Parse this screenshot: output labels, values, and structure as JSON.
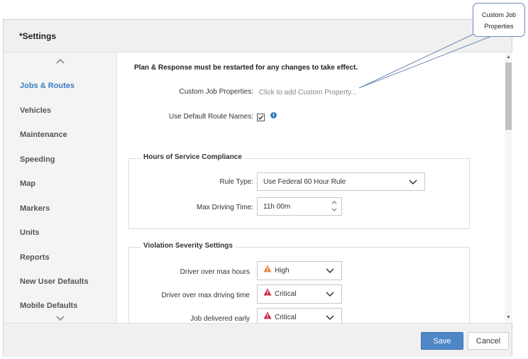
{
  "dialog": {
    "title": "*Settings",
    "sidebar": {
      "items": [
        {
          "label": "Jobs & Routes",
          "active": true
        },
        {
          "label": "Vehicles"
        },
        {
          "label": "Maintenance"
        },
        {
          "label": "Speeding"
        },
        {
          "label": "Map"
        },
        {
          "label": "Markers"
        },
        {
          "label": "Units"
        },
        {
          "label": "Reports"
        },
        {
          "label": "New User Defaults"
        },
        {
          "label": "Mobile Defaults"
        }
      ]
    },
    "notice": "Plan & Response must be restarted for any changes to take effect.",
    "custom_job_properties": {
      "label": "Custom Job Properties:",
      "placeholder": "Click to add Custom Property..."
    },
    "default_route_names": {
      "label": "Use Default Route Names:",
      "checked": true
    },
    "hours_of_service": {
      "legend": "Hours of Service Compliance",
      "rule_type_label": "Rule Type:",
      "rule_type_value": "Use Federal 60 Hour Rule",
      "max_driving_label": "Max Driving Time:",
      "max_driving_value": "11h 00m"
    },
    "violation_severity": {
      "legend": "Violation Severity Settings",
      "rows": [
        {
          "label": "Driver over max hours",
          "value": "High",
          "color": "#e8843a"
        },
        {
          "label": "Driver over max driving time",
          "value": "Critical",
          "color": "#c8283c"
        },
        {
          "label": "Job delivered early",
          "value": "Critical",
          "color": "#c8283c"
        }
      ]
    },
    "footer": {
      "save_label": "Save",
      "cancel_label": "Cancel"
    }
  },
  "callout": {
    "line1": "Custom Job",
    "line2": "Properties"
  },
  "icons": {
    "scroll_up": "chevron-up-icon",
    "scroll_down": "chevron-down-icon",
    "info": "info-icon",
    "dropdown": "chevron-down-icon",
    "warning": "warning-triangle-icon"
  }
}
